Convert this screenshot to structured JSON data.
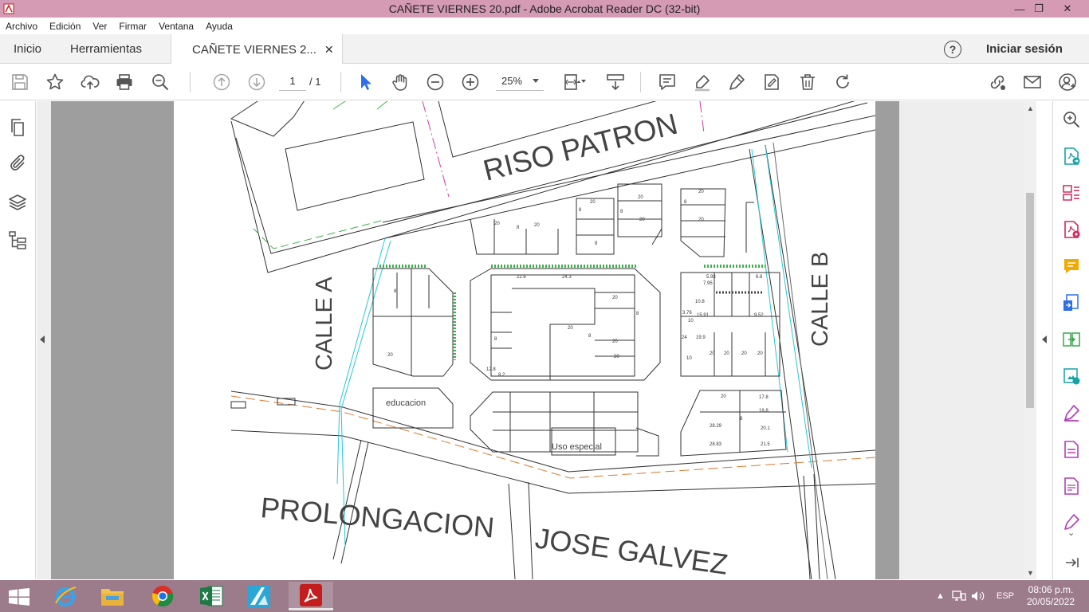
{
  "window": {
    "title": "CAÑETE VIERNES 20.pdf - Adobe Acrobat Reader DC (32-bit)",
    "minimize_glyph": "—",
    "restore_glyph": "❐",
    "close_glyph": "✕"
  },
  "menu": {
    "items": [
      "Archivo",
      "Edición",
      "Ver",
      "Firmar",
      "Ventana",
      "Ayuda"
    ]
  },
  "tabs": {
    "home": "Inicio",
    "tools": "Herramientas",
    "document": "CAÑETE VIERNES 2...",
    "close_glyph": "✕",
    "help_glyph": "?",
    "signin": "Iniciar sesión"
  },
  "toolbar": {
    "page_current": "1",
    "page_total": "/ 1",
    "zoom": "25%"
  },
  "plan": {
    "street_riso_patron": "RISO PATRON",
    "street_calle_a": "CALLE A",
    "street_calle_b": "CALLE B",
    "street_prolongacion": "PROLONGACION",
    "street_jose_galvez": "JOSE GALVEZ",
    "label_educacion": "educacion",
    "label_uso_especial": "Uso especial",
    "lot_numbers": [
      "20",
      "8",
      "20",
      "8",
      "20",
      "8",
      "22.6",
      "24.3",
      "20",
      "8",
      "20",
      "20",
      "8",
      "20",
      "8",
      "12.8",
      "8.2",
      "20",
      "8",
      "20",
      "20",
      "8",
      "20",
      "8",
      "17.8",
      "18.8",
      "20.1",
      "28.29",
      "28.83",
      "21.5",
      "20",
      "8",
      "5.93",
      "6.8",
      "7.95",
      "10.8",
      "3.76",
      "15.91",
      "9.52",
      "10",
      "24",
      "19.9",
      "10",
      "20",
      "20",
      "20",
      "20",
      "20"
    ]
  },
  "taskbar": {
    "language": "ESP",
    "time": "08:06 p.m.",
    "date": "20/05/2022"
  },
  "colors": {
    "title_bar": "#d59bb5",
    "taskbar": "#9c7b8a",
    "accent_red": "#d41f1f",
    "tool_purple": "#b33fb8",
    "tool_teal": "#17a2a8",
    "tool_yellow": "#f2a900",
    "tool_blue": "#2d6fe8"
  }
}
